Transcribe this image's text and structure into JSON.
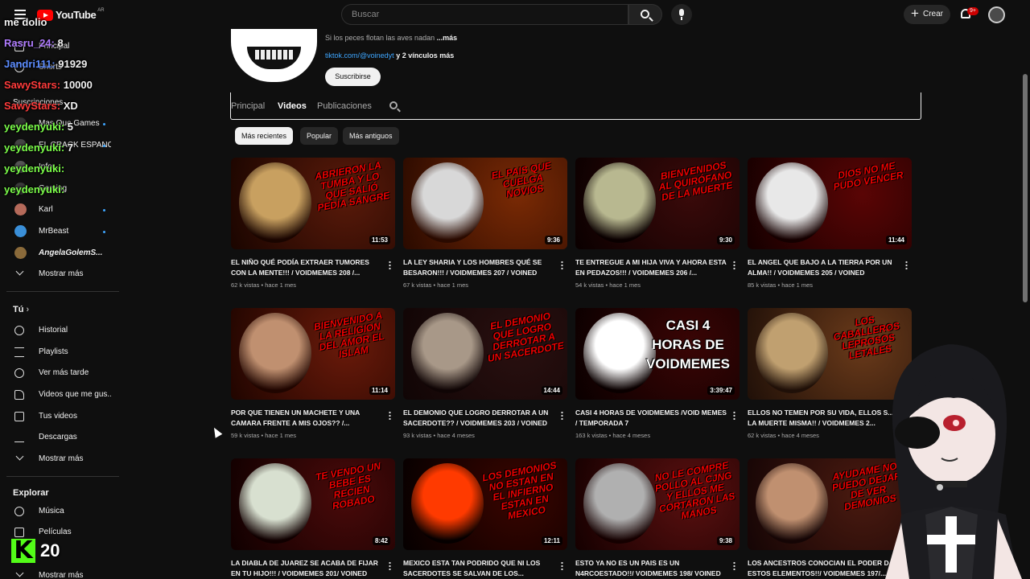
{
  "header": {
    "logo_text": "YouTube",
    "country_code": "AR",
    "search_placeholder": "Buscar",
    "create_label": "Crear",
    "notification_count": "9+"
  },
  "sidebar": {
    "items": [
      {
        "label": "Principal",
        "icon": "home-icon"
      },
      {
        "label": "Shorts",
        "icon": "shorts-icon"
      },
      {
        "label": "Suscripciones",
        "icon": "subscriptions-icon"
      }
    ],
    "subscriptions": [
      {
        "label": "Mas Que Games"
      },
      {
        "label": "EL CRACK ESPAÑOL"
      },
      {
        "label": "Infor..."
      },
      {
        "label": "Gaming"
      },
      {
        "label": "Karl"
      },
      {
        "label": "MrBeast"
      },
      {
        "label": "AngelaGolemS..."
      }
    ],
    "show_more_1": "Mostrar más",
    "you_heading": "Tú",
    "you_items": [
      {
        "label": "Historial",
        "icon": "history-icon"
      },
      {
        "label": "Playlists",
        "icon": "playlists-icon"
      },
      {
        "label": "Ver más tarde",
        "icon": "watch-later-icon"
      },
      {
        "label": "Videos que me gus...",
        "icon": "like-icon"
      },
      {
        "label": "Tus videos",
        "icon": "your-videos-icon"
      },
      {
        "label": "Descargas",
        "icon": "download-icon"
      }
    ],
    "show_more_2": "Mostrar más",
    "explore_heading": "Explorar",
    "explore_items": [
      {
        "label": "Música",
        "icon": "music-icon"
      },
      {
        "label": "Películas",
        "icon": "movies-icon"
      }
    ],
    "show_more_3": "Mostrar más"
  },
  "chat_overlay": [
    {
      "user": "me dolio",
      "text": "",
      "color": "#ffffff"
    },
    {
      "user": "Rasru_24:",
      "text": "8",
      "color": "#b07cff"
    },
    {
      "user": "Jandri111:",
      "text": "91929",
      "color": "#5b8cff"
    },
    {
      "user": "SawyStars:",
      "text": "10000",
      "color": "#ff3b3b"
    },
    {
      "user": "SawyStars:",
      "text": "XD",
      "color": "#ff3b3b"
    },
    {
      "user": "yeydenyuki:",
      "text": "5",
      "color": "#7cff4a"
    },
    {
      "user": "yeydenyuki:",
      "text": "7",
      "color": "#7cff4a"
    },
    {
      "user": "yeydenyuki:",
      "text": "",
      "color": "#7cff4a"
    },
    {
      "user": "yeydenyuki:",
      "text": "",
      "color": "#7cff4a"
    }
  ],
  "counter": {
    "badge": "K",
    "value": "20"
  },
  "channel": {
    "description": "Si los peces flotan las aves nadan",
    "more_label": "...más",
    "link_url": "tiktok.com/@voinedyt",
    "link_rest": "y 2 vínculos más",
    "subscribe_label": "Suscribirse"
  },
  "tabs": [
    {
      "label": "Principal",
      "selected": false
    },
    {
      "label": "Videos",
      "selected": true
    },
    {
      "label": "Publicaciones",
      "selected": false
    }
  ],
  "chips": [
    {
      "label": "Más recientes",
      "selected": true
    },
    {
      "label": "Popular",
      "selected": false
    },
    {
      "label": "Más antiguos",
      "selected": false
    }
  ],
  "videos": [
    {
      "title": "EL NIÑO QUÉ PODÍA EXTRAER TUMORES CON LA MENTE!!! / VOIDMEMES 208 /...",
      "meta": "62 k vistas • hace 1 mes",
      "duration": "11:53",
      "thumb_text": "ABRIERON LA TUMBA Y LO QUE SALIÓ PEDÍA SANGRE"
    },
    {
      "title": "LA LEY SHARIA Y LOS HOMBRES QUÉ SE BESARON!!! / VOIDMEMES 207 / VOINED",
      "meta": "67 k vistas • hace 1 mes",
      "duration": "9:36",
      "thumb_text": "EL PAIS QUE CUELGA NOVIOS"
    },
    {
      "title": "TE ENTREGUE A MI HIJA VIVA Y AHORA ESTA EN PEDAZOS!!! / VOIDMEMES 206 /...",
      "meta": "54 k vistas • hace 1 mes",
      "duration": "9:30",
      "thumb_text": "BIENVENIDOS AL QUIRÓFANO DE LA MUERTE"
    },
    {
      "title": "EL ANGEL QUE BAJO A LA TIERRA POR UN ALMA!! / VOIDMEMES 205 / VOINED",
      "meta": "85 k vistas • hace 1 mes",
      "duration": "11:44",
      "thumb_text": "DIOS NO ME PUDO VENCER"
    },
    {
      "title": "POR QUE TIENEN UN MACHETE Y UNA CAMARA FRENTE A MIS OJOS?? /...",
      "meta": "59 k vistas • hace 1 mes",
      "duration": "11:14",
      "thumb_text": "BIENVENIDO A LA RELIGION DEL AMOR EL ISLAM"
    },
    {
      "title": "EL DEMONIO QUE LOGRO DERROTAR A UN SACERDOTE?? / VOIDMEMES 203 / VOINED",
      "meta": "93 k vistas • hace 4 meses",
      "duration": "14:44",
      "thumb_text": "EL DEMONIO QUE LOGRO DERROTAR A UN SACERDOTE"
    },
    {
      "title": "CASI 4 HORAS DE VOIDMEMES /VOID MEMES / TEMPORADA 7",
      "meta": "163 k vistas • hace 4 meses",
      "duration": "3:39:47",
      "thumb_text": "CASI 4 HORAS DE VOIDMEMES"
    },
    {
      "title": "ELLOS NO TEMEN POR SU VIDA, ELLOS S... LA MUERTE MISMA!! / VOIDMEMES 2...",
      "meta": "62 k vistas • hace 4 meses",
      "duration": "",
      "thumb_text": "LOS CABALLEROS LEPROSOS LETALES"
    },
    {
      "title": "LA DIABLA DE JUAREZ SE ACABA DE FIJAR EN TU HIJO!!! / VOIDMEMES 201/ VOINED",
      "meta": "",
      "duration": "8:42",
      "thumb_text": "TE VENDO UN BEBE ES RECIEN ROBADO"
    },
    {
      "title": "MEXICO ESTA TAN PODRIDO QUE NI LOS SACERDOTES SE SALVAN DE LOS...",
      "meta": "",
      "duration": "12:11",
      "thumb_text": "LOS DEMONIOS NO ESTAN EN EL INFIERNO ESTAN EN MEXICO"
    },
    {
      "title": "ESTO YA NO ES UN PAIS ES UN N4RCOESTADO!!/ VOIDMEMES 198/ VOINED",
      "meta": "",
      "duration": "9:38",
      "thumb_text": "NO LE COMPRE POLLO AL CJNG Y ELLOS ME CORTARON LAS MANOS"
    },
    {
      "title": "LOS ANCESTROS CONOCIAN EL PODER D... ESTOS ELEMENTOS!!/ VOIDMEMES 197/...",
      "meta": "",
      "duration": "",
      "thumb_text": "AYUDAME NO PUEDO DEJAR DE VER DEMONIOS"
    }
  ]
}
